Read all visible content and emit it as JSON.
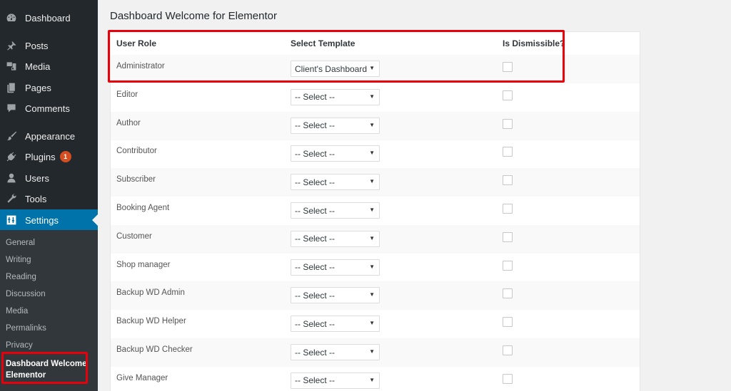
{
  "sidebar": {
    "menu": [
      {
        "label": "Dashboard",
        "icon": "dashboard-icon"
      },
      {
        "label": "Posts",
        "icon": "pin-icon"
      },
      {
        "label": "Media",
        "icon": "media-icon"
      },
      {
        "label": "Pages",
        "icon": "pages-icon"
      },
      {
        "label": "Comments",
        "icon": "comment-icon"
      },
      {
        "label": "Appearance",
        "icon": "paintbrush-icon"
      },
      {
        "label": "Plugins",
        "icon": "plugin-icon",
        "badge": "1"
      },
      {
        "label": "Users",
        "icon": "user-icon"
      },
      {
        "label": "Tools",
        "icon": "wrench-icon"
      },
      {
        "label": "Settings",
        "icon": "settings-icon",
        "active": true
      }
    ],
    "submenu": [
      "General",
      "Writing",
      "Reading",
      "Discussion",
      "Media",
      "Permalinks",
      "Privacy"
    ],
    "submenu_current": [
      "Dashboard Welcome",
      "Elementor"
    ]
  },
  "colors": {
    "accent": "#0073aa",
    "highlight": "#e8000b",
    "badge": "#d54e21",
    "sidebar_bg": "#23282d"
  },
  "main": {
    "title": "Dashboard Welcome for Elementor",
    "columns": [
      "User Role",
      "Select Template",
      "Is Dismissible?"
    ],
    "rows": [
      {
        "role": "Administrator",
        "template": "Client's Dashboard",
        "dismissible": false
      },
      {
        "role": "Editor",
        "template": "-- Select --",
        "dismissible": false
      },
      {
        "role": "Author",
        "template": "-- Select --",
        "dismissible": false
      },
      {
        "role": "Contributor",
        "template": "-- Select --",
        "dismissible": false
      },
      {
        "role": "Subscriber",
        "template": "-- Select --",
        "dismissible": false
      },
      {
        "role": "Booking Agent",
        "template": "-- Select --",
        "dismissible": false
      },
      {
        "role": "Customer",
        "template": "-- Select --",
        "dismissible": false
      },
      {
        "role": "Shop manager",
        "template": "-- Select --",
        "dismissible": false
      },
      {
        "role": "Backup WD Admin",
        "template": "-- Select --",
        "dismissible": false
      },
      {
        "role": "Backup WD Helper",
        "template": "-- Select --",
        "dismissible": false
      },
      {
        "role": "Backup WD Checker",
        "template": "-- Select --",
        "dismissible": false
      },
      {
        "role": "Give Manager",
        "template": "-- Select --",
        "dismissible": false
      }
    ]
  }
}
